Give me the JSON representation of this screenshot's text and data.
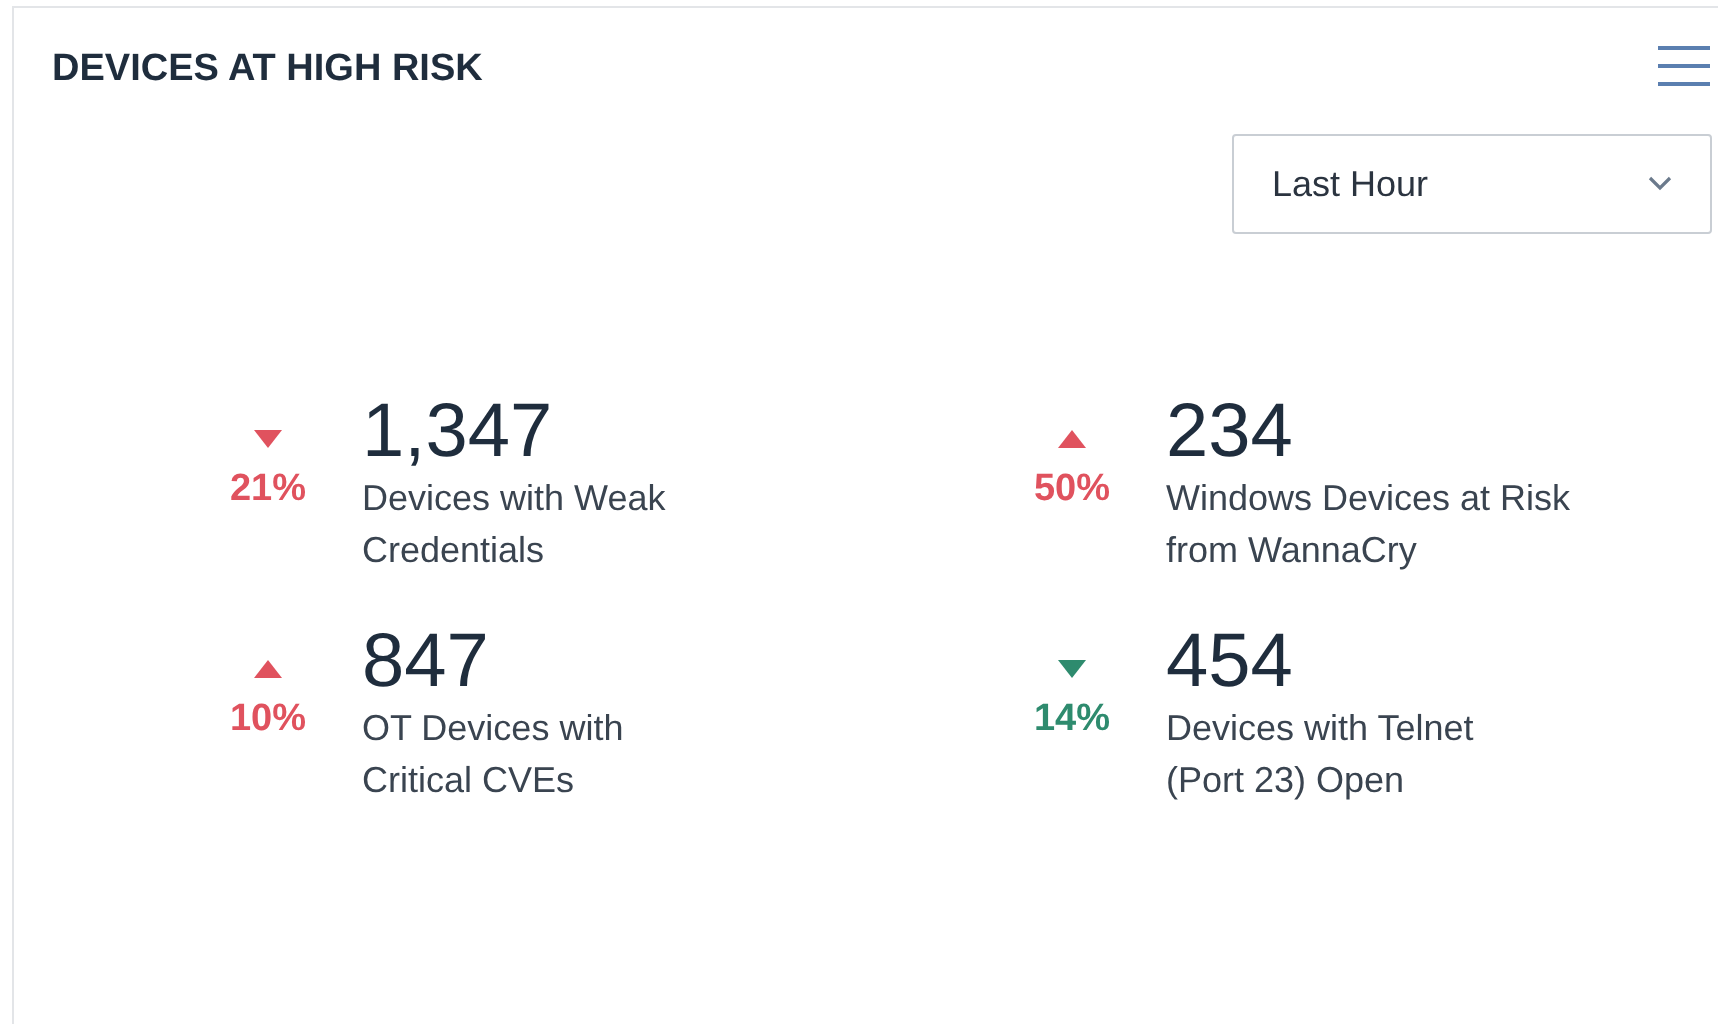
{
  "card": {
    "title": "DEVICES AT HIGH RISK"
  },
  "range_select": {
    "value": "Last Hour"
  },
  "stats": [
    {
      "value": "1,347",
      "change": "21%",
      "kind": "down",
      "color": "#e0525e",
      "label_lines": [
        "Devices with Weak",
        "Credentials"
      ]
    },
    {
      "value": "234",
      "change": "50%",
      "kind": "up",
      "color": "#e0525e",
      "label_lines": [
        "Windows Devices at Risk",
        "from WannaCry"
      ]
    },
    {
      "value": "847",
      "change": "10%",
      "kind": "up",
      "color": "#e0525e",
      "label_lines": [
        "OT Devices with",
        "Critical CVEs"
      ]
    },
    {
      "value": "454",
      "change": "14%",
      "kind": "down",
      "color": "#2e8b6e",
      "label_lines": [
        "Devices with Telnet",
        "(Port 23) Open"
      ]
    }
  ]
}
